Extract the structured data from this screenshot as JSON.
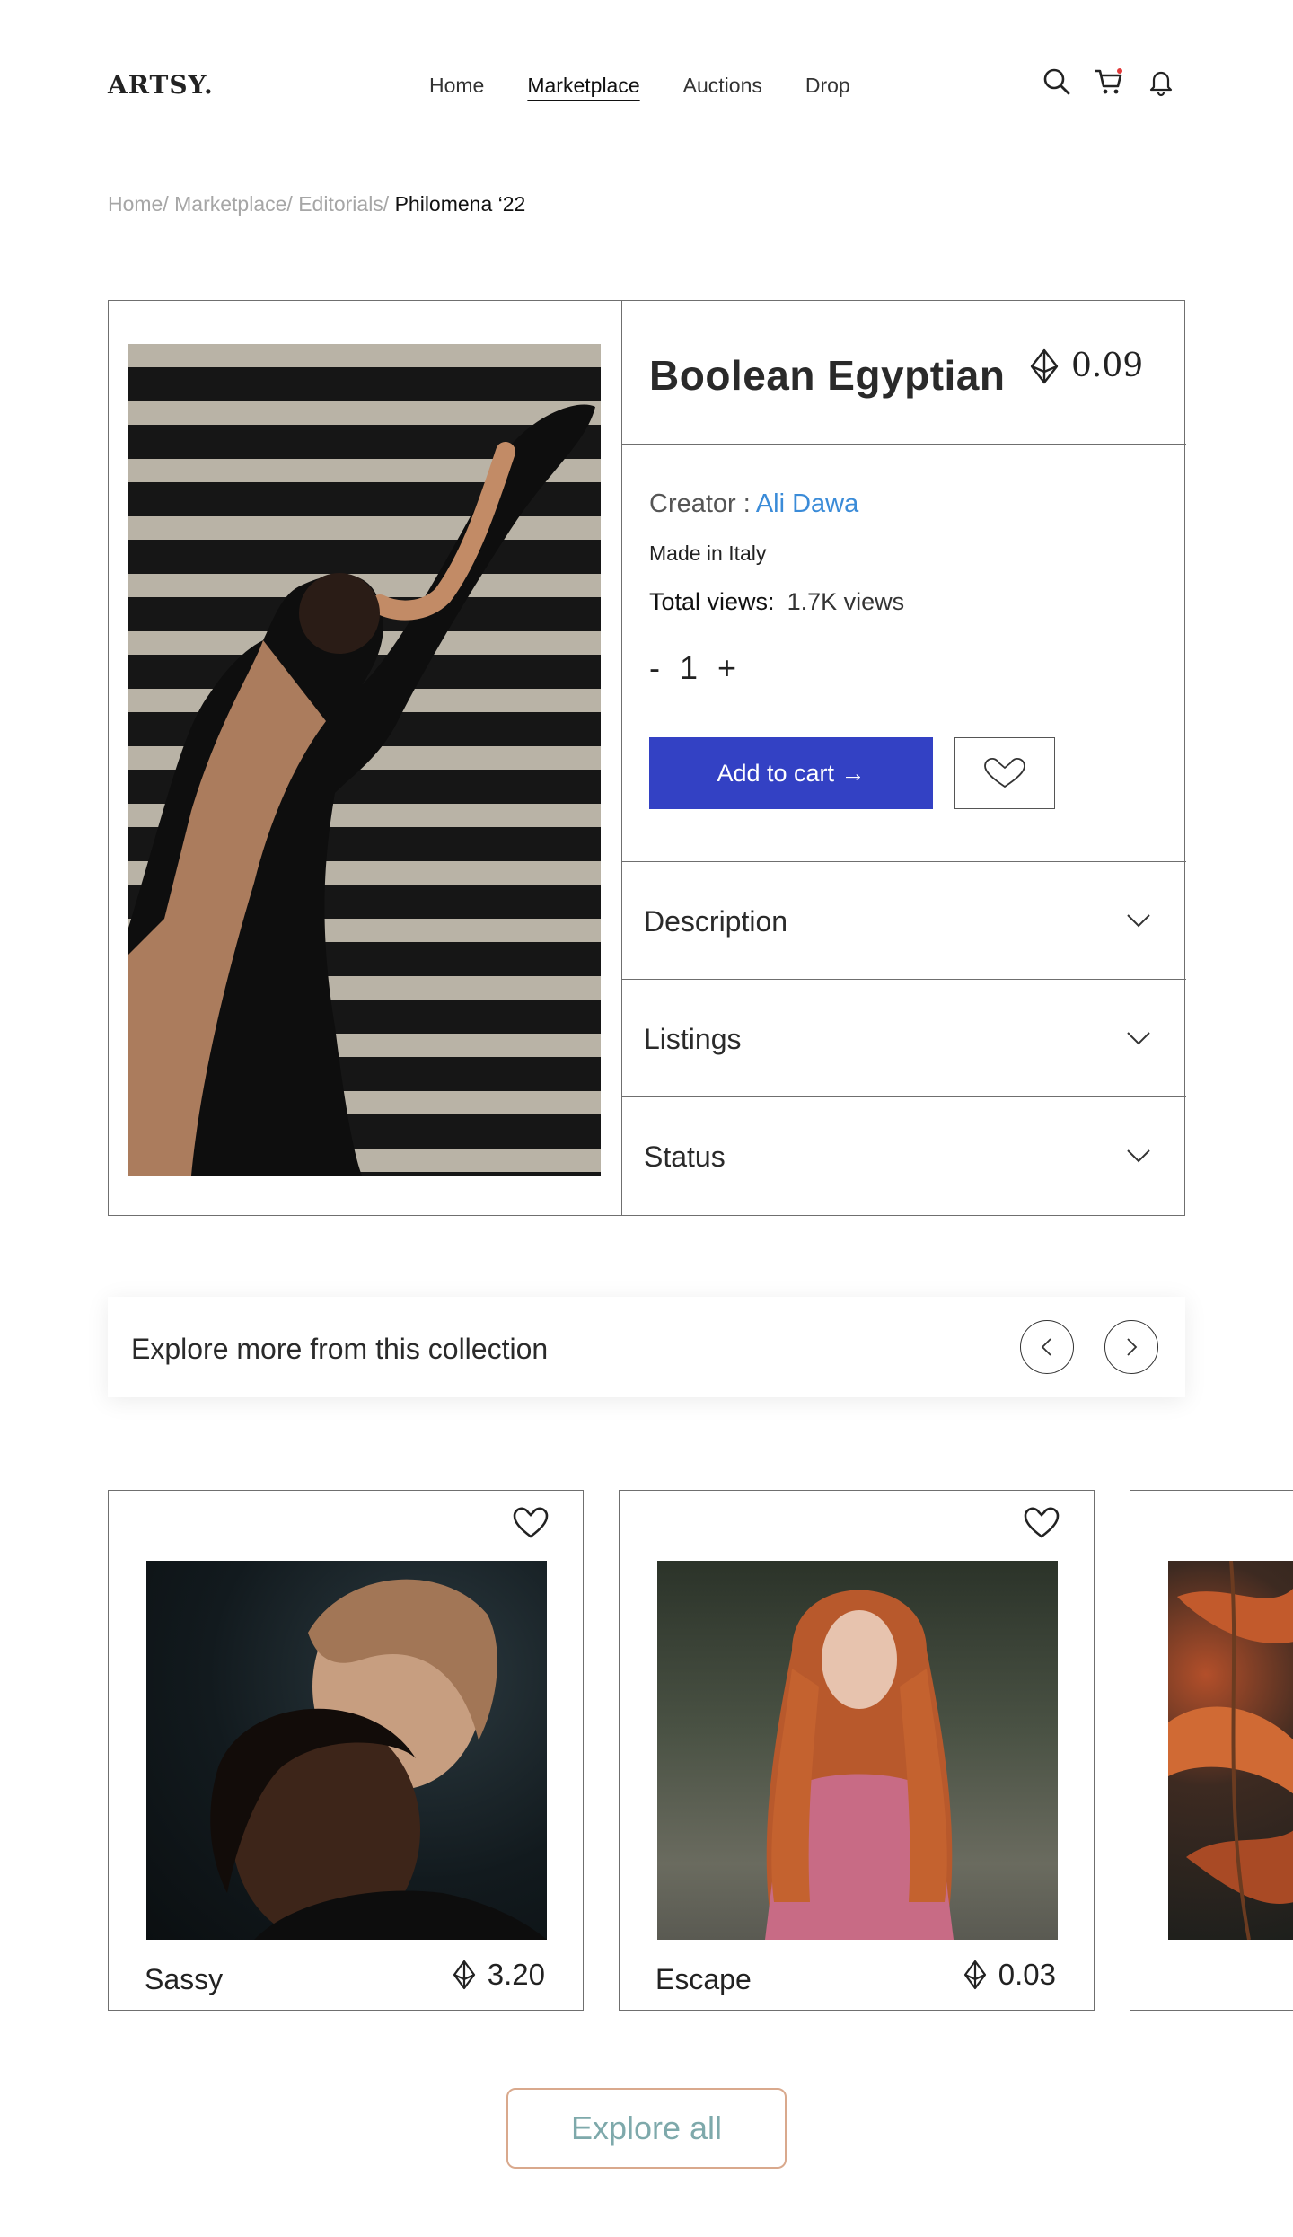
{
  "brand": {
    "logo": "ARTSY."
  },
  "nav": {
    "items": [
      "Home",
      "Marketplace",
      "Auctions",
      "Drop"
    ],
    "active": "Marketplace"
  },
  "header_icons": [
    "search-icon",
    "cart-icon",
    "bell-icon"
  ],
  "breadcrumb": {
    "items": [
      "Home/",
      "Marketplace/",
      "Editorials/"
    ],
    "current": "Philomena ‘22"
  },
  "product": {
    "title": "Boolean Egyptian",
    "price": "0.09",
    "currency_icon": "ethereum-icon",
    "creator_label": "Creator :",
    "creator_name": "Ali Dawa",
    "made_in": "Made in Italy",
    "views_label": "Total views:",
    "views_value": "1.7K views",
    "qty_minus": "-",
    "qty_value": "1",
    "qty_plus": "+",
    "add_to_cart": "Add to cart →",
    "accordions": [
      "Description",
      "Listings",
      "Status"
    ]
  },
  "explore": {
    "label": "Explore more from this collection"
  },
  "cards": [
    {
      "name": "Sassy",
      "price": "3.20"
    },
    {
      "name": "Escape",
      "price": "0.03"
    }
  ],
  "explore_all": "Explore all",
  "colors": {
    "accent": "#3341c4",
    "link": "#3a8bd8",
    "notification_dot": "#e23a3a"
  }
}
